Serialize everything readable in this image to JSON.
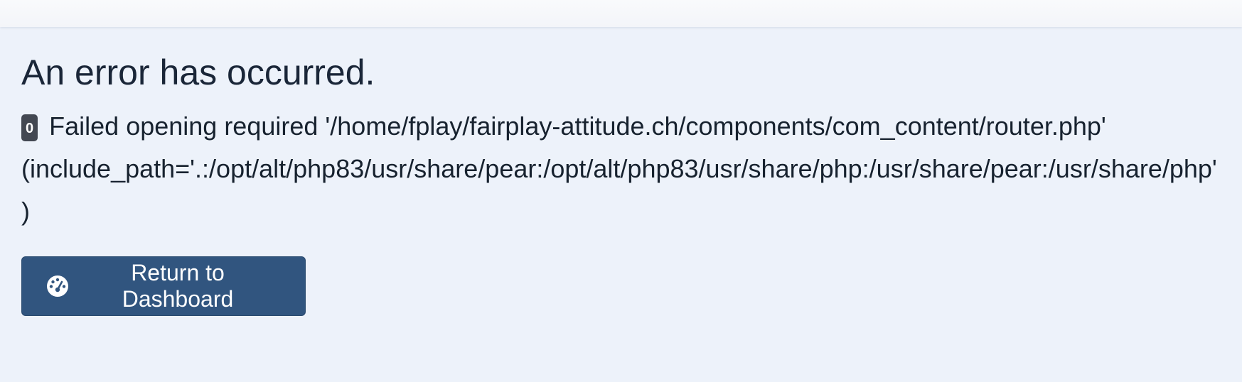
{
  "error": {
    "title": "An error has occurred.",
    "code": "0",
    "message": "Failed opening required '/home/fplay/fairplay-attitude.ch/components/com_content/router.php' (include_path='.:/opt/alt/php83/usr/share/pear:/opt/alt/php83/usr/share/php:/usr/share/pear:/usr/share/php')"
  },
  "actions": {
    "return_label": "Return to Dashboard",
    "return_icon": "dashboard-gauge-icon"
  },
  "colors": {
    "background": "#edf2fa",
    "button": "#31557f",
    "badge": "#434852",
    "text": "#1a2638"
  }
}
